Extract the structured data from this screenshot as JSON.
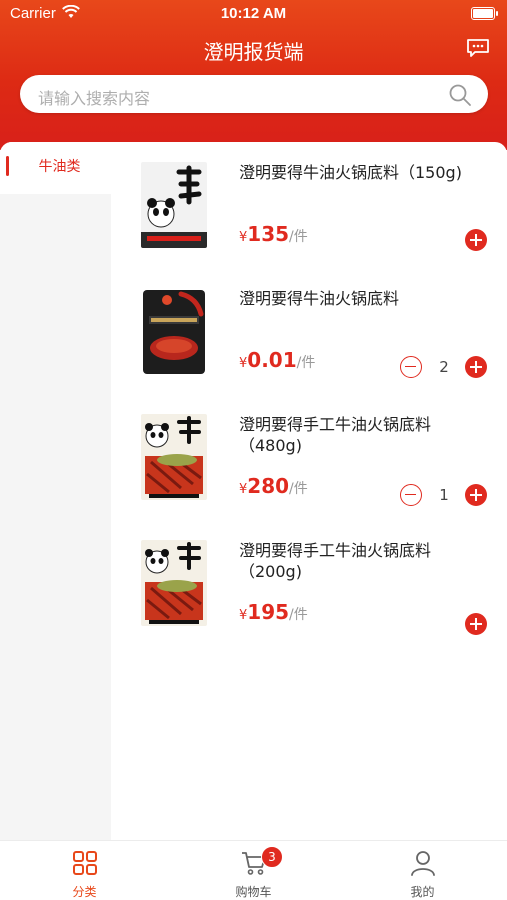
{
  "status_bar": {
    "carrier": "Carrier",
    "time": "10:12 AM"
  },
  "header": {
    "title": "澄明报货端",
    "search_placeholder": "请输入搜索内容"
  },
  "sidebar": {
    "items": [
      {
        "label": "牛油类",
        "active": true
      }
    ]
  },
  "products": [
    {
      "name": "澄明要得牛油火锅底料（150g)",
      "currency": "¥",
      "price": "135",
      "unit": "/件",
      "quantity": null,
      "image": "panda-tallow-pack"
    },
    {
      "name": "澄明要得牛油火锅底料",
      "currency": "¥",
      "price": "0.01",
      "unit": "/件",
      "quantity": "2",
      "image": "black-chili-pack"
    },
    {
      "name": "澄明要得手工牛油火锅底料（480g)",
      "currency": "¥",
      "price": "280",
      "unit": "/件",
      "quantity": "1",
      "image": "panda-handmade-pack"
    },
    {
      "name": "澄明要得手工牛油火锅底料（200g)",
      "currency": "¥",
      "price": "195",
      "unit": "/件",
      "quantity": null,
      "image": "panda-handmade-pack"
    }
  ],
  "tabbar": {
    "tabs": [
      {
        "label": "分类",
        "icon": "grid-icon",
        "active": true
      },
      {
        "label": "购物车",
        "icon": "cart-icon",
        "badge": "3"
      },
      {
        "label": "我的",
        "icon": "user-icon"
      }
    ]
  },
  "colors": {
    "accent": "#e02a1f",
    "header_top": "#e8481a",
    "sidebar_bg": "#f5f5f5"
  }
}
